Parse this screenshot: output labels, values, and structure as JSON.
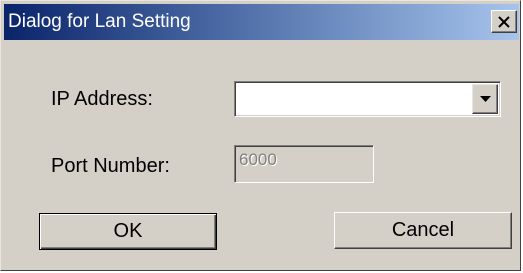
{
  "window": {
    "title": "Dialog for Lan Setting",
    "close_icon": "close-icon"
  },
  "form": {
    "ip_label": "IP Address:",
    "ip_value": "",
    "ip_dropdown_icon": "chevron-down-icon",
    "port_label": "Port Number:",
    "port_value": "6000",
    "port_enabled": false
  },
  "buttons": {
    "ok_label": "OK",
    "cancel_label": "Cancel"
  },
  "colors": {
    "title_start": "#0a246a",
    "title_end": "#a6c4ec",
    "face": "#d4d0c8"
  }
}
